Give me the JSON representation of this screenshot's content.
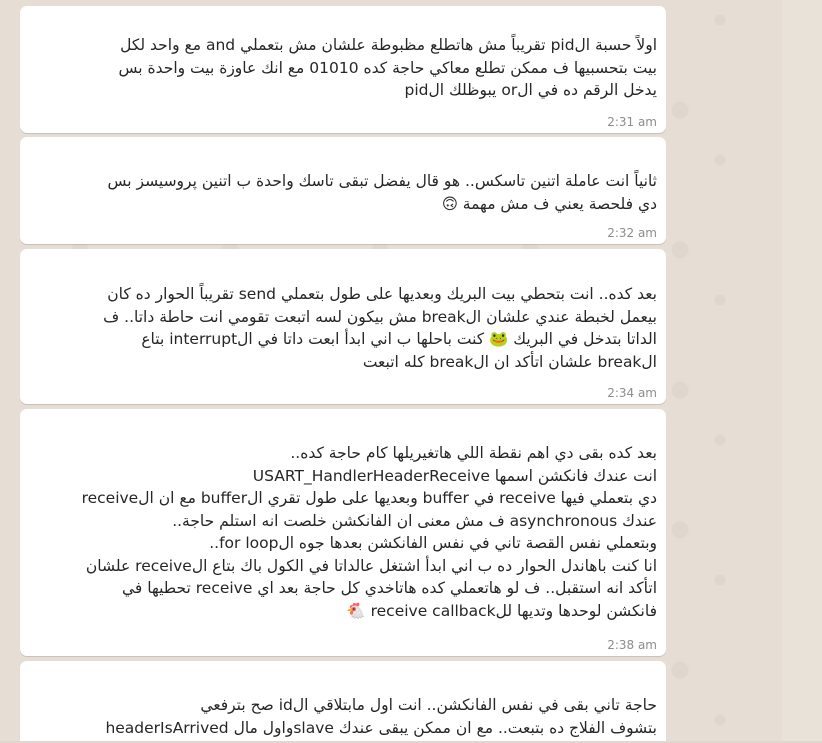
{
  "messages": [
    {
      "text": "اولاً حسبة الpid تقريباً مش هاتطلع مظبوطة علشان مش بتعملي and مع واحد لكل\nبيت بتحسبيها ف ممكن تطلع معاكي حاجة كده 01010 مع انك عاوزة بيت واحدة بس\nيدخل الرقم ده في الor يبوظلك الpid",
      "time": "2:31 am"
    },
    {
      "text": "ثانياً انت عاملة اتنين تاسكس.. هو قال يفضل تبقى تاسك واحدة ب اتنين پروسيسز بس\nدي فلحصة يعني ف مش مهمة 🙃",
      "time": "2:32 am"
    },
    {
      "text": "بعد كده.. انت بتحطي بيت البريك وبعديها على طول بتعملي send تقريباً الحوار ده كان\nبيعمل لخبطة عندي علشان الbreak مش بيكون لسه اتبعت تقومي انت حاطة داتا.. ف\nالداتا بتدخل في البريك 🐸 كنت باحلها ب اني ابدأ ابعت داتا في الinterrupt بتاع\nالbreak علشان اتأكد ان الbreak كله اتبعت",
      "time": "2:34 am"
    },
    {
      "text": "بعد كده بقى دي اهم نقطة اللي هاتغيريلها كام حاجة كده..\nانت عندك فانكشن اسمها USART_HandlerHeaderReceive\nدي بتعملي فيها receive في buffer وبعديها على طول تقري الbuffer مع ان الreceive\nعندك asynchronous ف مش معنى ان الفانكشن خلصت انه استلم حاجة..\nوبتعملي نفس القصة تاني في نفس الفانكشن بعدها جوه الfor loop..\nانا كنت باهاندل الحوار ده ب اني ابدأ اشتغل عالداتا في الكول باك بتاع الreceive علشان\nاتأكد انه استقبل.. ف لو هاتعملي كده هاتاخدي كل حاجة بعد اي receive تحطيها في\nفانكشن لوحدها وتديها للreceive callback 🐔",
      "time": "2:38 am"
    },
    {
      "text": "حاجة تاني بقى في نفس الفانكشن.. انت اول مابتلاقي الid صح بترفعي\nheaderIsArrived واول مالslave بتشوف الفلاج ده بتبعت.. مع ان ممكن يبقى عندك",
      "time": ""
    }
  ],
  "icons": {
    "check": "check-icon"
  }
}
